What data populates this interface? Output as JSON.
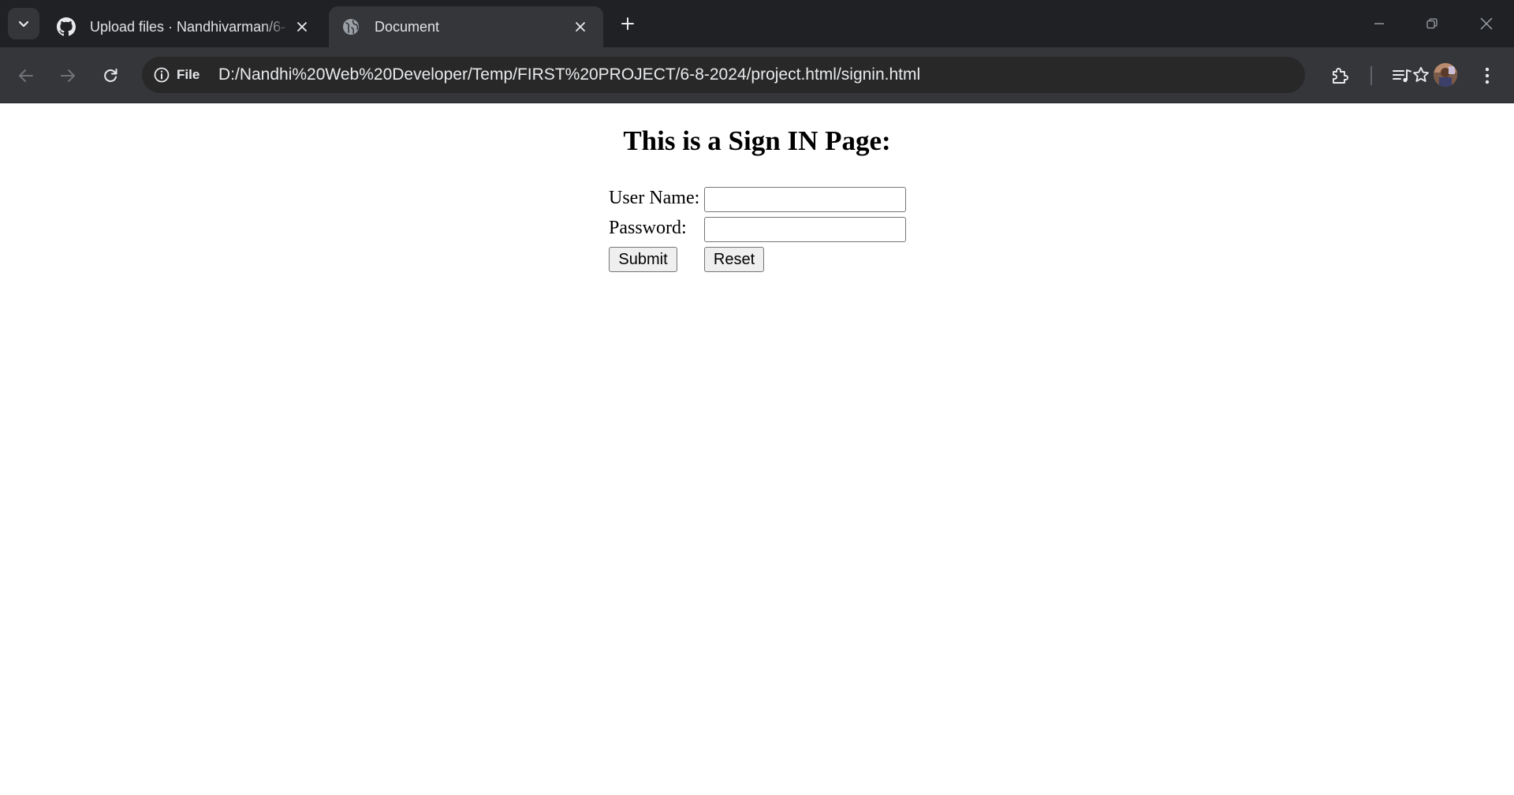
{
  "browser": {
    "tabs": [
      {
        "title": "Upload files · Nandhivarman/6-",
        "favicon": "github-icon",
        "active": false
      },
      {
        "title": "Document",
        "favicon": "globe-icon",
        "active": true
      }
    ],
    "address_bar": {
      "site_chip_label": "File",
      "url": "D:/Nandhi%20Web%20Developer/Temp/FIRST%20PROJECT/6-8-2024/project.html/signin.html"
    },
    "icons": [
      "tab-search-icon",
      "close-icon",
      "plus-icon",
      "minimize-icon",
      "restore-icon",
      "back-arrow-icon",
      "forward-arrow-icon",
      "reload-icon",
      "info-icon",
      "star-icon",
      "extensions-puzzle-icon",
      "media-control-icon",
      "profile-avatar",
      "more-vert-icon"
    ],
    "colors": {
      "tabstrip": "#202124",
      "toolbar": "#35363a",
      "omnibox": "#282828",
      "text": "#e8eaed"
    }
  },
  "page": {
    "heading": "This is a Sign IN Page:",
    "form": {
      "username_label": "User Name:",
      "username_value": "",
      "password_label": "Password:",
      "password_value": "",
      "submit_label": "Submit",
      "reset_label": "Reset"
    }
  }
}
